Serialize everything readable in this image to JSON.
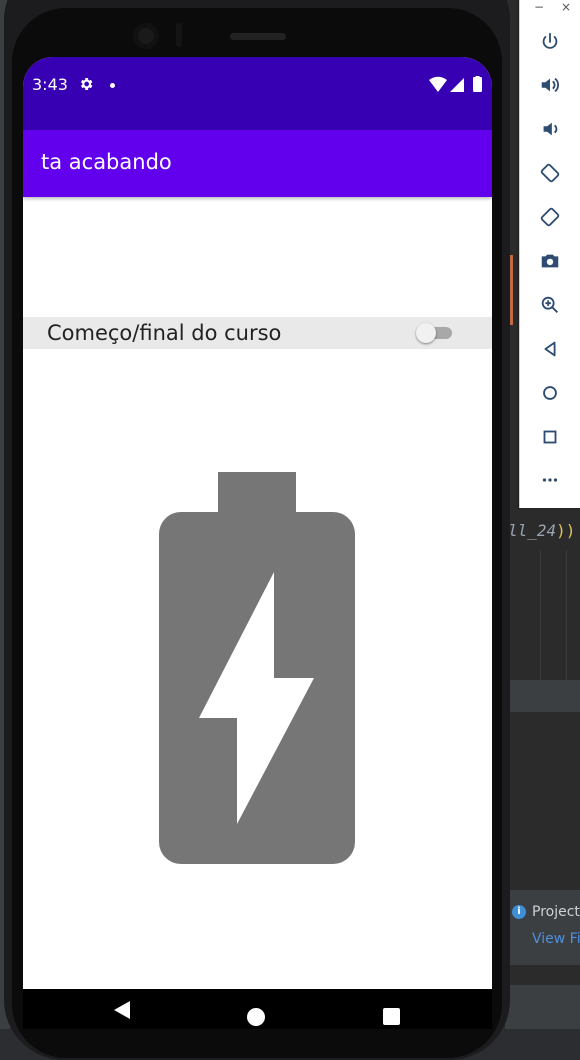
{
  "status_bar": {
    "time": "3:43"
  },
  "app_bar": {
    "title": "ta acabando"
  },
  "switch_row": {
    "label": "Começo/final do curso",
    "checked": false
  },
  "main": {
    "image_icon": "battery-charging-icon"
  },
  "emulator_toolbar": {
    "window_controls": [
      "−",
      "×"
    ],
    "buttons": [
      "power-icon",
      "volume-up-icon",
      "volume-down-icon",
      "rotate-left-icon",
      "rotate-right-icon",
      "camera-icon",
      "zoom-icon",
      "back-icon",
      "home-icon",
      "overview-icon",
      "more-icon"
    ]
  },
  "ide": {
    "code_snippet": "ll_24",
    "code_snippet_close": "))",
    "notification_title": "Project",
    "notification_link": "View Fi"
  },
  "colors": {
    "status_bar": "#3700b3",
    "app_bar": "#6200ee",
    "battery": "#767676"
  }
}
